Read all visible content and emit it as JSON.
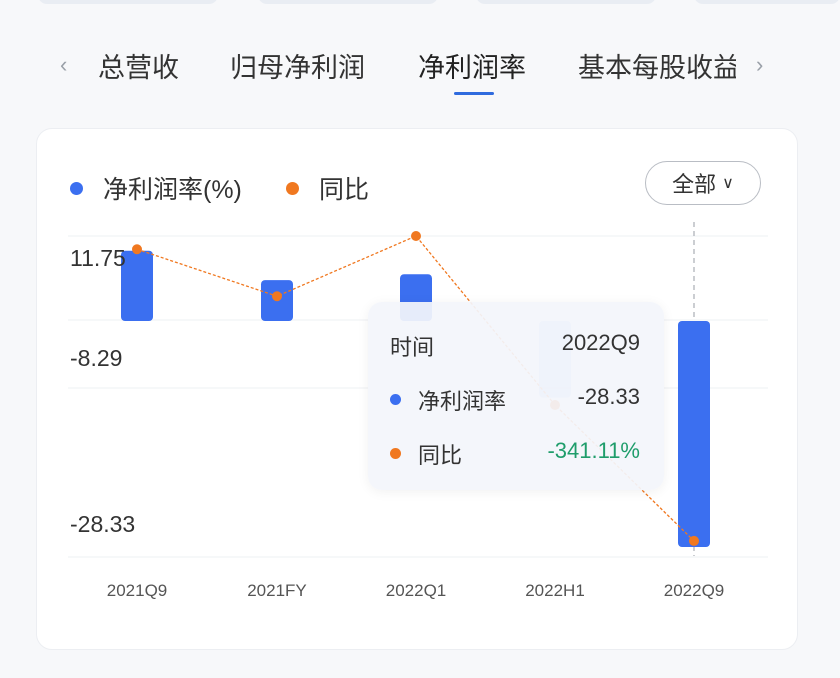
{
  "tabs": {
    "items": [
      {
        "label": "总营收",
        "active": false
      },
      {
        "label": "归母净利润",
        "active": false
      },
      {
        "label": "净利润率",
        "active": true
      },
      {
        "label": "基本每股收益",
        "active": false
      }
    ]
  },
  "legend": {
    "series_a": "净利润率(%)",
    "series_b": "同比"
  },
  "scope_button": {
    "label": "全部"
  },
  "chart_data": {
    "type": "bar",
    "categories": [
      "2021Q9",
      "2021FY",
      "2022Q1",
      "2022H1",
      "2022Q9"
    ],
    "y_tick_labels": [
      "11.75",
      "-8.29",
      "-28.33"
    ],
    "series": [
      {
        "name": "净利润率(%)",
        "kind": "bar",
        "color": "#3b6ff0",
        "values": [
          12.0,
          8.0,
          8.8,
          -8.0,
          -28.33
        ]
      },
      {
        "name": "同比",
        "kind": "line",
        "color": "#f07820",
        "values": [
          12.2,
          5.8,
          14.0,
          -9.0,
          -27.5
        ]
      }
    ],
    "ylim": [
      -28.33,
      11.75
    ],
    "highlighted_category": "2022Q9"
  },
  "tooltip": {
    "time_label": "时间",
    "time_value": "2022Q9",
    "row1_label": "净利润率",
    "row1_value": "-28.33",
    "row2_label": "同比",
    "row2_value": "-341.11%",
    "row2_value_color": "#1f9d6b"
  },
  "colors": {
    "bar": "#3b6ff0",
    "line": "#f07820",
    "accent": "#2f6bde"
  }
}
